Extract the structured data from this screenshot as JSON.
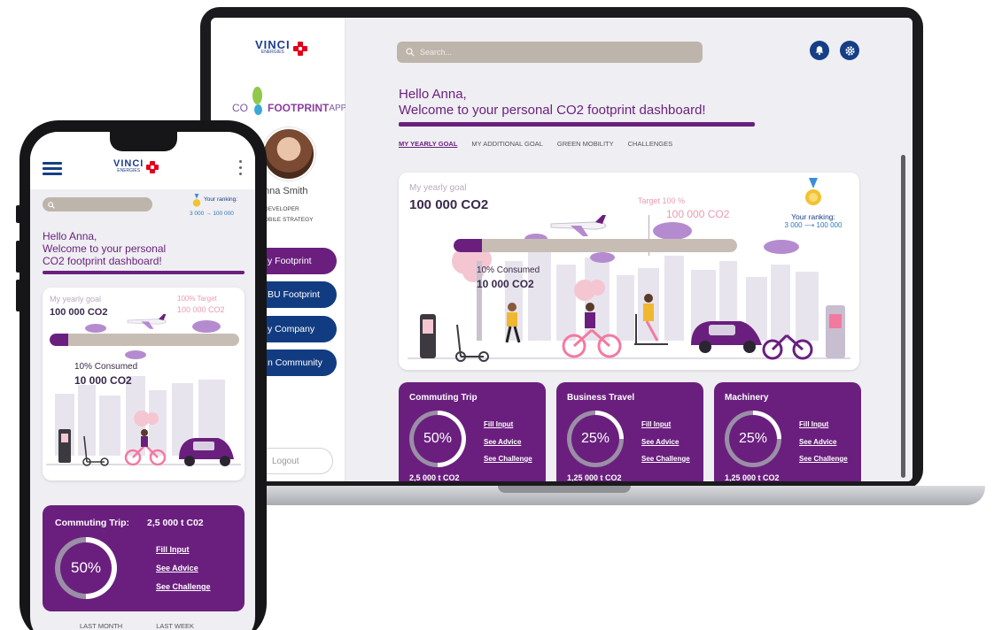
{
  "laptop": {
    "sidebar": {
      "vinci_logo": "VINCI",
      "vinci_sub": "ENERGIES",
      "app_logo_prefix": "CO",
      "app_logo_main": "FOOTPRINT",
      "app_logo_suffix": "APP",
      "user_name": "nna Smith",
      "user_role_line1": "DEVELOPER",
      "user_role_line2": "OBILE STRATEGY",
      "nav": [
        {
          "label": "y Footprint"
        },
        {
          "label": "BU Footprint"
        },
        {
          "label": "y Company"
        },
        {
          "label": "n Community"
        }
      ],
      "logout_label": "Logout"
    },
    "header": {
      "search_placeholder": "Search..."
    },
    "greeting_line1": "Hello Anna,",
    "greeting_line2": "Welcome to your personal CO2 footprint dashboard!",
    "tabs": [
      "MY YEARLY GOAL",
      "MY ADDITIONAL GOAL",
      "GREEN MOBILITY",
      "CHALLENGES"
    ],
    "goal_card": {
      "goal_label": "My yearly goal",
      "goal_value": "100 000 CO2",
      "target_label": "Target 100 %",
      "target_value": "100 000 CO2",
      "consumed_label": "10% Consumed",
      "consumed_value": "10 000 CO2",
      "consumed_fraction": 0.1,
      "ranking_label": "Your ranking:",
      "ranking_from": "3 000",
      "ranking_arrow": "⟶",
      "ranking_to": "100 000"
    },
    "cards": [
      {
        "title": "Commuting Trip",
        "percent": "50%",
        "fraction": 0.5,
        "fill": "Fill Input",
        "advice": "See Advice",
        "challenge": "See Challenge",
        "value": "2,5 000 t CO2"
      },
      {
        "title": "Business Travel",
        "percent": "25%",
        "fraction": 0.25,
        "fill": "Fill Input",
        "advice": "See Advice",
        "challenge": "See Challenge",
        "value": "1,25 000 t CO2"
      },
      {
        "title": "Machinery",
        "percent": "25%",
        "fraction": 0.25,
        "fill": "Fill Input",
        "advice": "See Advice",
        "challenge": "See Challenge",
        "value": "1,25 000 t CO2"
      }
    ]
  },
  "phone": {
    "vinci_logo": "VINCI",
    "vinci_sub": "ENERGIES",
    "ranking_label": "Your ranking:",
    "ranking_from": "3 000",
    "ranking_arrow": "→",
    "ranking_to": "100 000",
    "greeting_line1": "Hello Anna,",
    "greeting_line2": "Welcome to your personal",
    "greeting_line3": "CO2 footprint dashboard!",
    "goal_card": {
      "goal_label": "My yearly goal",
      "goal_value": "100 000 CO2",
      "target_label": "100% Target",
      "target_value": "100 000 CO2",
      "consumed_label": "10% Consumed",
      "consumed_value": "10 000 CO2",
      "consumed_fraction": 0.1
    },
    "card": {
      "title": "Commuting Trip:",
      "value": "2,5 000 t C02",
      "percent": "50%",
      "fraction": 0.5,
      "fill": "Fill Input",
      "advice": "See Advice",
      "challenge": "See Challenge"
    },
    "bottom_tabs": [
      "LAST MONTH",
      "LAST WEEK"
    ]
  },
  "colors": {
    "purple": "#6a1f7e",
    "navy": "#153e86",
    "vinci_red": "#e2001a",
    "lilac": "#b58bcf"
  },
  "icons": [
    "search-icon",
    "bell-icon",
    "settings-icon",
    "medal-icon",
    "hamburger-menu-icon",
    "more-vert-icon",
    "airplane-icon",
    "footprint-icon"
  ]
}
